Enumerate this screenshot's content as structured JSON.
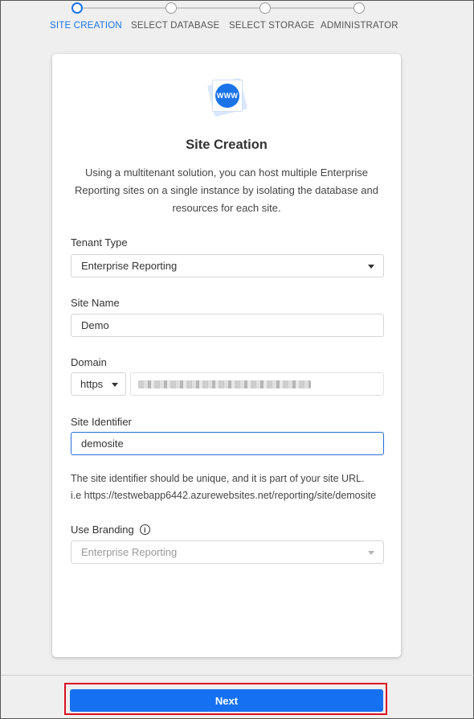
{
  "stepper": {
    "steps": [
      {
        "label": "SITE CREATION"
      },
      {
        "label": "SELECT DATABASE"
      },
      {
        "label": "SELECT STORAGE"
      },
      {
        "label": "ADMINISTRATOR"
      }
    ]
  },
  "card": {
    "logo_text": "WWW",
    "title": "Site Creation",
    "description": "Using a multitenant solution, you can host multiple Enterprise Reporting sites on a single instance by isolating the database and resources for each site.",
    "tenant_type": {
      "label": "Tenant Type",
      "value": "Enterprise Reporting"
    },
    "site_name": {
      "label": "Site Name",
      "value": "Demo"
    },
    "domain": {
      "label": "Domain",
      "protocol": "https"
    },
    "site_identifier": {
      "label": "Site Identifier",
      "value": "demosite"
    },
    "hint": {
      "line1": "The site identifier should be unique, and it is part of your site URL.",
      "line2": "i.e https://testwebapp6442.azurewebsites.net/reporting/site/demosite"
    },
    "branding": {
      "label": "Use Branding",
      "value": "Enterprise Reporting"
    }
  },
  "footer": {
    "next_label": "Next"
  },
  "colors": {
    "accent": "#1670f2",
    "highlight": "#d9101f"
  }
}
